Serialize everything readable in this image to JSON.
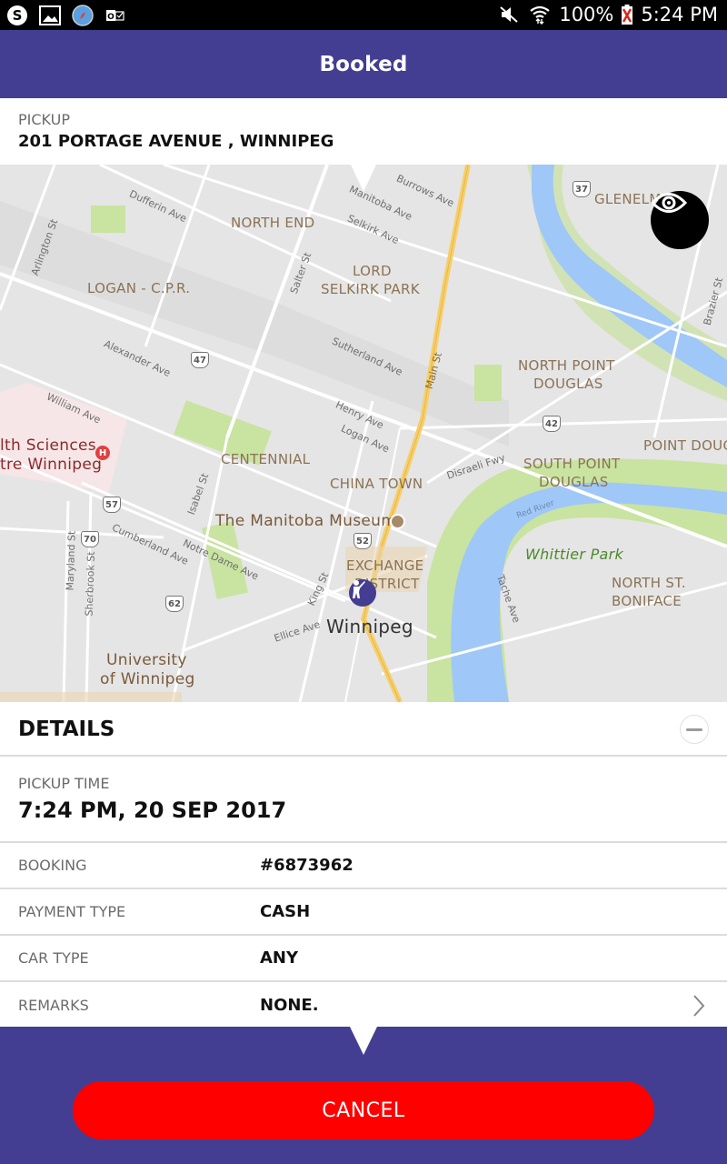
{
  "status_bar": {
    "notification_icons": [
      "skype-icon",
      "gallery-icon",
      "browser-icon",
      "outlook-icon"
    ],
    "battery_percent": "100%",
    "time": "5:24 PM"
  },
  "app_bar": {
    "title": "Booked"
  },
  "pickup": {
    "label": "PICKUP",
    "address": "201 PORTAGE AVENUE , WINNIPEG"
  },
  "map": {
    "neighborhoods": [
      "NORTH END",
      "LORD",
      "SELKIRK PARK",
      "LOGAN - C.P.R.",
      "NORTH POINT",
      "DOUGLAS",
      "POINT DOUG",
      "SOUTH POINT",
      "DOUGLAS",
      "CENTENNIAL",
      "CHINA TOWN",
      "EXCHANGE",
      "DISTRICT",
      "NORTH ST.",
      "BONIFACE",
      "GLENELM"
    ],
    "pois": {
      "hospital_line1": "lth Sciences",
      "hospital_line2": "tre Winnipeg",
      "museum": "The Manitoba Museum",
      "university_line1": "University",
      "university_line2": "of Winnipeg",
      "park": "Whittier Park",
      "city": "Winnipeg",
      "river": "Red River"
    },
    "streets": [
      "Dufferin Ave",
      "Burrows Ave",
      "Manitoba Ave",
      "Selkirk Ave",
      "Arlington St",
      "Salter St",
      "Alexander Ave",
      "Sutherland Ave",
      "Main St",
      "William Ave",
      "Henry Ave",
      "Logan Ave",
      "Disraeli Fwy",
      "Isabel St",
      "Cumberland Ave",
      "Notre Dame Ave",
      "Maryland St",
      "Sherbrook St",
      "King St",
      "Ellice Ave",
      "Tache Ave",
      "Brazier St"
    ],
    "route_shields": [
      "37",
      "47",
      "42",
      "57",
      "70",
      "52",
      "62"
    ]
  },
  "details": {
    "title": "DETAILS",
    "pickup_time_label": "PICKUP TIME",
    "pickup_time_value": "7:24 PM, 20 SEP 2017",
    "rows": [
      {
        "label": "BOOKING",
        "value": "#6873962"
      },
      {
        "label": "PAYMENT TYPE",
        "value": "CASH"
      },
      {
        "label": "CAR TYPE",
        "value": "ANY"
      },
      {
        "label": "REMARKS",
        "value": "NONE."
      }
    ]
  },
  "actions": {
    "cancel_label": "CANCEL"
  },
  "colors": {
    "primary": "#433e91",
    "danger": "#fe0000"
  }
}
